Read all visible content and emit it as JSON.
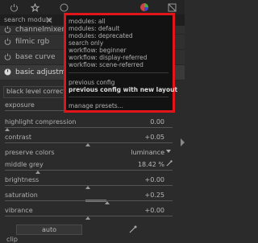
{
  "search": {
    "label": "search module"
  },
  "modules": [
    {
      "label": "channelmixerrgb"
    },
    {
      "label": "filmic rgb"
    },
    {
      "label": "base curve"
    },
    {
      "label": "basic adjustments"
    }
  ],
  "black_level": {
    "label": "black level correction"
  },
  "params": {
    "exposure": {
      "label": "exposure",
      "value": ""
    },
    "highlight_compression": {
      "label": "highlight compression",
      "value": "0.00"
    },
    "contrast": {
      "label": "contrast",
      "value": "+0.05"
    },
    "preserve_colors": {
      "label": "preserve colors",
      "value": "luminance"
    },
    "middle_grey": {
      "label": "middle grey",
      "value": "18.42 %"
    },
    "brightness": {
      "label": "brightness",
      "value": "+0.00"
    },
    "saturation": {
      "label": "saturation",
      "value": "+0.25"
    },
    "vibrance": {
      "label": "vibrance",
      "value": "+0.00"
    }
  },
  "auto": {
    "label": "auto"
  },
  "clip": {
    "label": "clip"
  },
  "popup": {
    "items": [
      "modules: all",
      "modules: default",
      "modules: deprecated",
      "search only",
      "workflow: beginner",
      "workflow: display-referred",
      "workflow: scene-referred",
      "previous config",
      "previous config with new layout",
      "manage presets..."
    ]
  },
  "colors": {
    "popup_border": "#e2151b",
    "popup_bg": "#121212",
    "panel_bg": "#2b2b2b"
  }
}
